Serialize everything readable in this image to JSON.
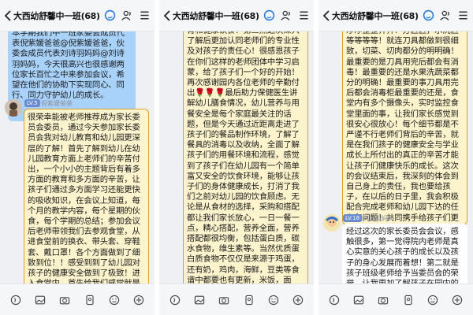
{
  "header": {
    "title": "大西幼舒馨中一班(68)"
  },
  "panel1": {
    "blue_text": "本学期我们中一班家委会成员代表倪紫媛爸爸@倪紫媛爸爸，伙委会成员代表刘诗羽妈妈@刘诗羽妈妈，今天很高兴也很感谢两位家长百忙之中来参加会议，希望在他们的协助下实现同心、同行、同力守护幼儿的成长。",
    "tag": "LV.5",
    "sender": "倪紫媛爸爸",
    "yellow_text": "很荣幸能被老师推荐成为家长委员会委员，通过今天参加家长委员会我对幼儿教育和幼儿园更深层的了解！首先了解到幼儿在幼儿园教育方面上老师们的辛苦付出，一个小小的主题背后有着多方面的教育和多方面的辛苦，让孩子们通过多方面学习还能更快的吸收知识，在会议上知道，每个月的教学内容，每个星期的伙食，每个学期的总结；参加会议后老师带领我们去参观食堂，从进食堂前的换衣、带头套、穿鞋套、戴口罩！各个方面做到了细致到位！！感受到到了幼儿园对孩子的健康安全做到了极致！进入食堂内，首先给我们感觉就是整洁、干净、有条理！消毒柜里面整整齐齐的碗筷，火灶台也是收拾的干干净净整整齐齐！分区区，水洗区等"
  },
  "panel2": {
    "yellow_text": "育和健康饮食！第三点这次深入了解后更加认同老师们的专业性及对孩子的责任心！很感恩孩子在你们这样的老师团体中学习启蒙，给了孩子们一个好的开始！再次感谢园内各位老师的辛勤付出🌹🌹🌹最后助力保健医生讲解幼儿膳食情况，幼儿营养与用餐安全是每个家庭最关注的话题，但是今天通过近距离走进了孩子们的餐品制作环境，了解了餐具的消毒以及收纳，全面了解孩子们的用餐环境和流程，感觉到了孩子们在幼儿园有一个简单富又安全的饮食环境，能够让孩子们的身体健康成长，打消了我们之前对幼儿园的饮食顾虑。无论是从食材的选择，采购和搭配都让我们家长放心，一日一餐一点，精心搭配，营养全面，营养搭配都很均衡，包括蛋白质，碳水食物，维生素等。当然优质蛋白质食物不仅仅是来源于鸡蛋，还有奶，鸡肉，海鲜，豆类等食谱中都要也有更新，米饭，面食，谷类粗粮营养搭配都很均衡，而且色香味俱全，让我们作为家长，更应该支持幼儿园的工作，在幼儿园的教育工作中，我们往往只是看到了表面，但是幼儿的健康成长，背后有老师付出更多的心血和努力，才能让孩子们获得更多的收获和成长。"
  },
  "panel3": {
    "yellow_text": "净净整整齐齐！分区区，水洗区等等等等！就连刀具都做到很细致，切菜、切肉都分的明明确！最重要的是刀具用完后都会有消毒！最重要的还是水果洗蔬菜都分的明确！最重要的事刀具用完后都会消毒柜最重要的还是，食堂内有多个摄像头，实时监控食堂里面的事，让我们家长感觉到很安心很放心！每个细节都是不严谨不行老师们背后的辛苦，就是在我们孩子的健康安全与学业成长上所付出的真正的辛苦才能让孩子们健康快乐的成长。这次的会议结束后，我深刻的体会到自己身上的责任，我也要给孩子，在以后的日子里，我会积极配合完成老师和幼儿园下达的任务和问题！共同携手给孩子们更好的教育！一起加油，创建更好的明天！再次感谢幼儿园全体老师，您们辛苦了，谢谢王老师和蒋老师让我担任家委会委员！我会好好努力！做好家委会委员的职责！",
    "tag": "LV.18",
    "sender": "刘诗羽妈妈",
    "white_text": "经过这次的家长委员会会议，感触很多，第一觉得院内老师是真心实意的关心孩子的成长以及孩子的身心发展而着想！第二就是孩子班级老师给予当委员会的荣誉，让我更加了解孩子在园内的生活环境，教"
  }
}
